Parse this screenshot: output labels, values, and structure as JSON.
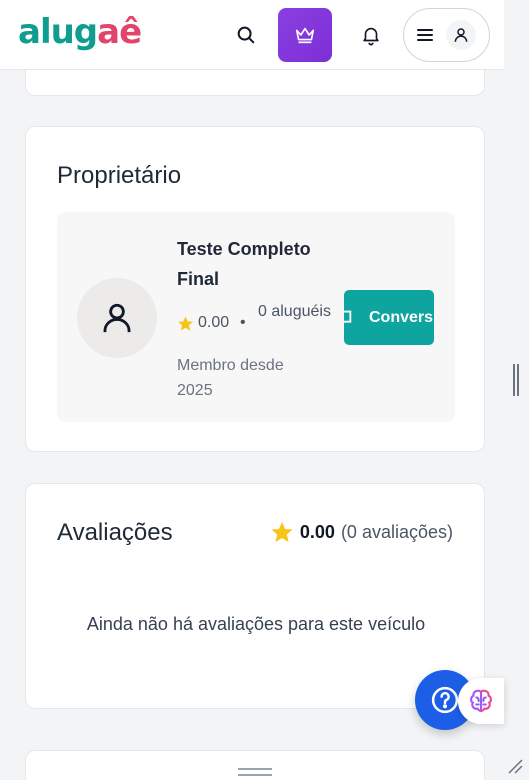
{
  "header": {
    "logo_part1": "alug",
    "logo_part2": "aê"
  },
  "owner": {
    "section_title": "Proprietário",
    "name": "Teste Completo Final",
    "rating": "0.00",
    "separator": "•",
    "rentals": "0 aluguéis",
    "member_since": "Membro desde 2025",
    "contact_label": "Convers"
  },
  "reviews": {
    "section_title": "Avaliações",
    "score": "0.00",
    "count_text": "(0 avaliações)",
    "empty_message": "Ainda não há avaliações para este veículo"
  },
  "colors": {
    "brand_teal": "#0f9d8f",
    "brand_pink": "#e3446b",
    "premium_purple": "#8b3fe0",
    "contact_teal": "#0ea5a0",
    "help_blue": "#1d5ee6",
    "star_yellow": "#f5c518"
  }
}
